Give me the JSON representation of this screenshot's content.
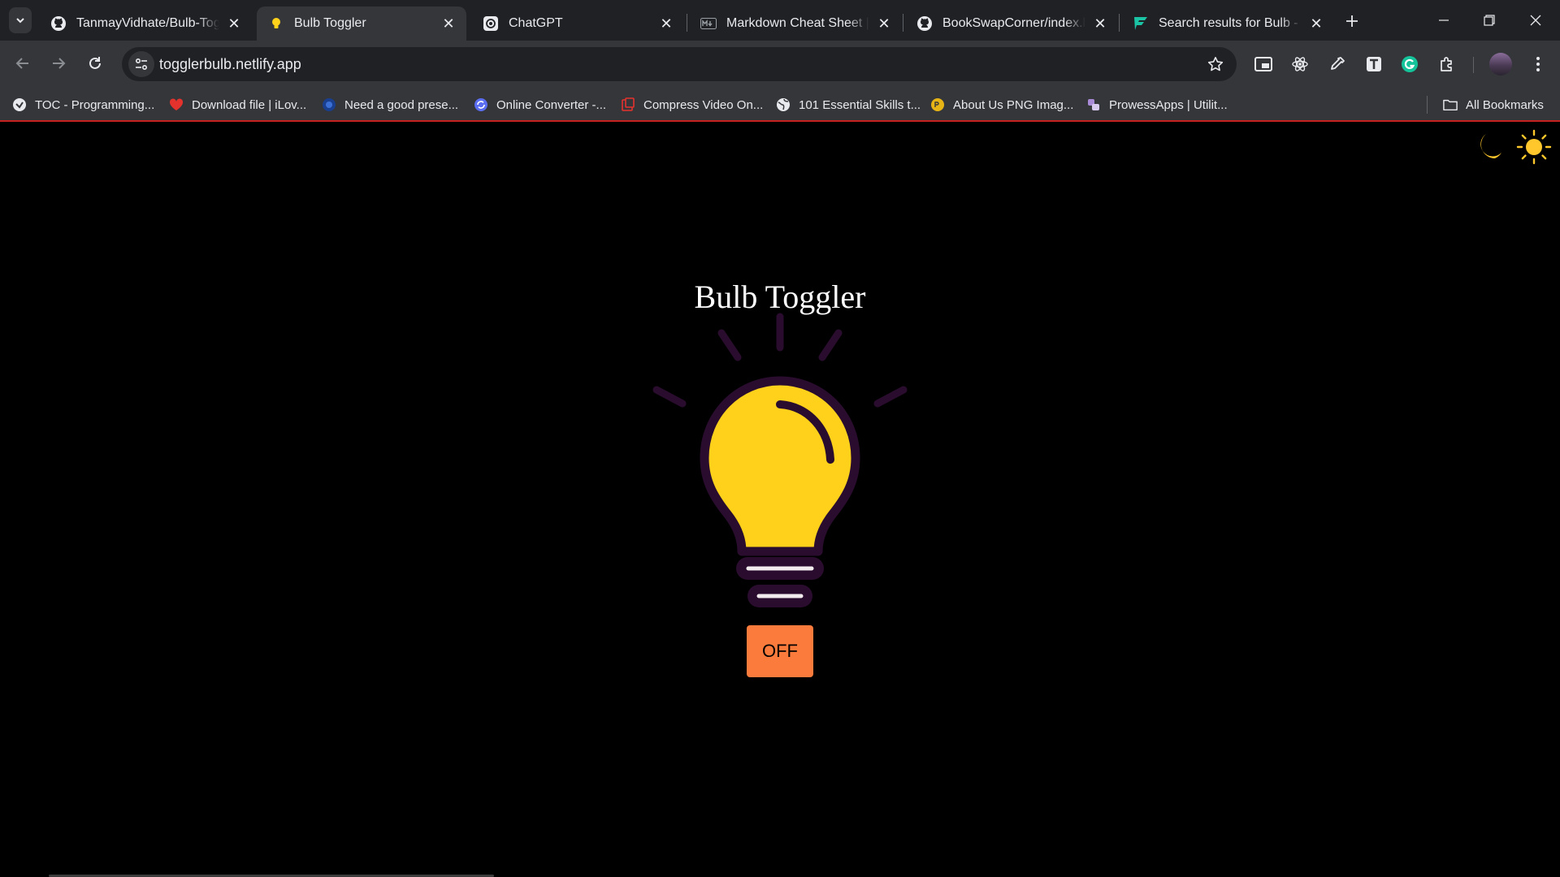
{
  "browser": {
    "tabs": [
      {
        "title": "TanmayVidhate/Bulb-Toggler",
        "icon": "github-icon",
        "active": false
      },
      {
        "title": "Bulb Toggler",
        "icon": "bulb-favicon-icon",
        "active": true
      },
      {
        "title": "ChatGPT",
        "icon": "chatgpt-icon",
        "active": false
      },
      {
        "title": "Markdown Cheat Sheet | Markdown Guide",
        "icon": "markdown-icon",
        "active": false
      },
      {
        "title": "BookSwapCorner/index.html",
        "icon": "github-icon",
        "active": false
      },
      {
        "title": "Search results for Bulb - Flaticon",
        "icon": "flaticon-icon",
        "active": false
      }
    ],
    "url": "togglerbulb.netlify.app",
    "bookmarks": [
      {
        "label": "TOC - Programming...",
        "icon": "toc-icon"
      },
      {
        "label": "Download file | iLov...",
        "icon": "heart-icon"
      },
      {
        "label": "Need a good prese...",
        "icon": "globe-blue-icon"
      },
      {
        "label": "Online Converter -...",
        "icon": "converter-icon"
      },
      {
        "label": "Compress Video On...",
        "icon": "compress-icon"
      },
      {
        "label": "101 Essential Skills t...",
        "icon": "globe-icon"
      },
      {
        "label": "About Us PNG Imag...",
        "icon": "png-icon"
      },
      {
        "label": "ProwessApps | Utilit...",
        "icon": "prowess-icon"
      }
    ],
    "all_bookmarks_label": "All Bookmarks"
  },
  "page": {
    "title": "Bulb Toggler",
    "button_label": "OFF",
    "bulb_color": "#ffd11a",
    "button_color": "#fb7b3c"
  }
}
